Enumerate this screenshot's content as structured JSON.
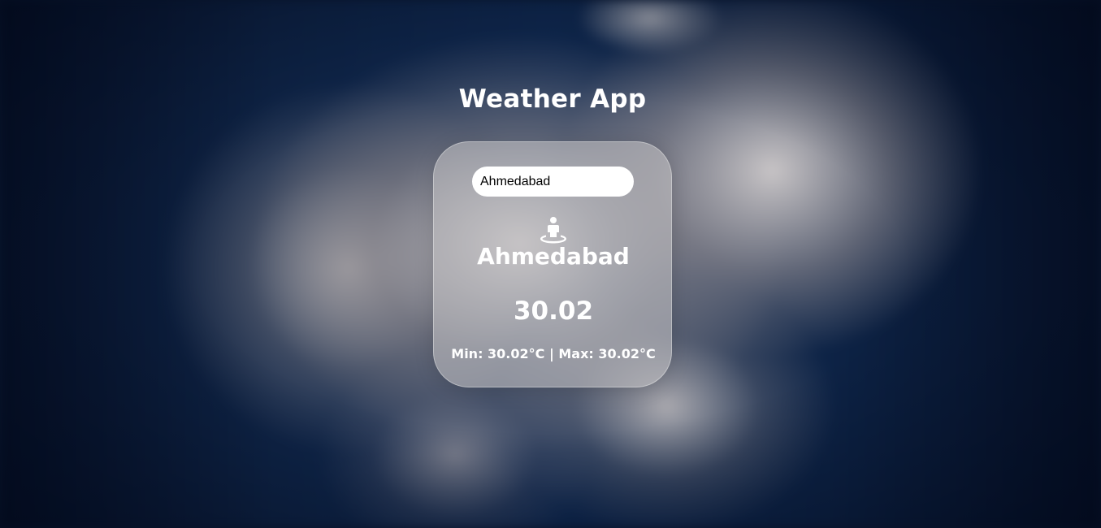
{
  "app": {
    "title": "Weather App"
  },
  "search": {
    "value": "Ahmedabad",
    "placeholder": ""
  },
  "weather": {
    "location_icon": "street-view-icon",
    "city": "Ahmedabad",
    "temperature": "30.02",
    "min_max": "Min: 30.02°C | Max: 30.02°C"
  },
  "colors": {
    "text": "#ffffff",
    "card_background": "rgba(200,198,200,0.55)",
    "input_background": "#ffffff"
  }
}
